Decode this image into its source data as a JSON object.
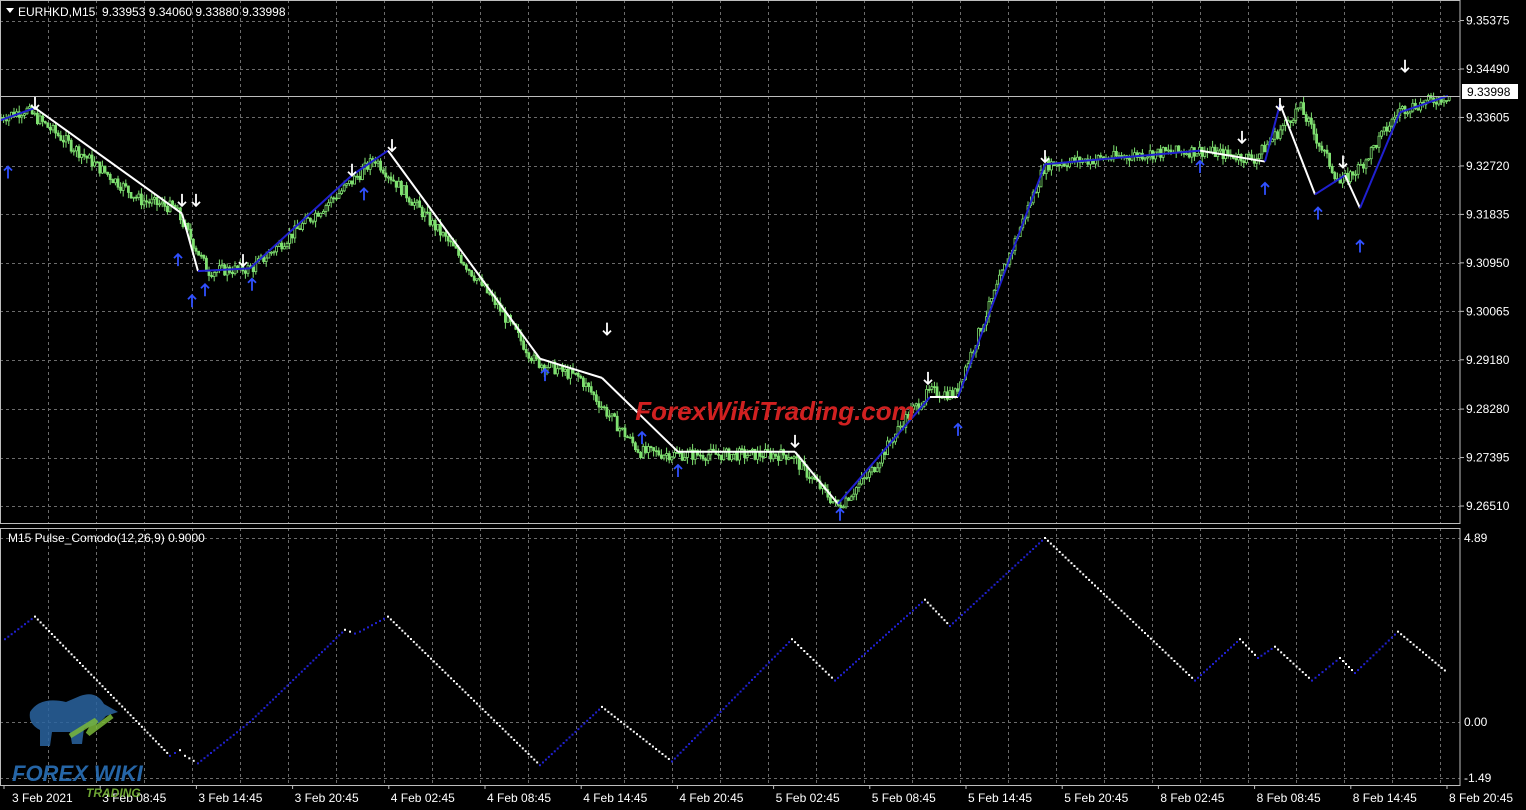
{
  "header": {
    "symbol": "EURHKD,M15",
    "ohlc": "9.33953 9.34060 9.33880 9.33998"
  },
  "current_price": "9.33998",
  "indicator": {
    "label": "M15 Pulse_Comodo(12,26,9) 0.9000"
  },
  "watermark": {
    "text": "ForexWikiTrading.com",
    "logo_line1": "FOREX WIKI",
    "logo_line2": "TRADING"
  },
  "colors": {
    "background": "#000000",
    "grid": "#6b6b6b",
    "candles": "#7fe070",
    "zigzag_down": "#ffffff",
    "zigzag_up": "#2020d0",
    "arrow_up": "#3050ff",
    "arrow_down": "#ffffff",
    "watermark": "#d02020"
  },
  "chart_data": [
    {
      "type": "line",
      "series": [
        {
          "name": "",
          "x": [
            0,
            26,
            140,
            175,
            208,
            252,
            300,
            350,
            375,
            450,
            500,
            535,
            580,
            612,
            640,
            678,
            720,
            790,
            838,
            870,
            905,
            930,
            955,
            1045,
            1100,
            1150,
            1200,
            1255,
            1300,
            1340,
            1360,
            1400,
            1448
          ],
          "y": [
            9.336,
            9.3375,
            9.321,
            9.3195,
            9.308,
            9.3085,
            9.316,
            9.324,
            9.3285,
            9.313,
            9.301,
            9.2915,
            9.2885,
            9.281,
            9.275,
            9.2745,
            9.2745,
            9.2745,
            9.265,
            9.271,
            9.281,
            9.286,
            9.2855,
            9.3275,
            9.3285,
            9.3295,
            9.33,
            9.3285,
            9.338,
            9.324,
            9.327,
            9.3375,
            9.34
          ]
        }
      ],
      "zigzag": {
        "x": [
          0,
          35,
          182,
          198,
          250,
          352,
          388,
          540,
          602,
          678,
          795,
          838,
          930,
          958,
          1045,
          1200,
          1265,
          1280,
          1315,
          1345,
          1360,
          1400,
          1448
        ],
        "y": [
          9.3355,
          9.3378,
          9.3185,
          9.308,
          9.3085,
          9.3255,
          9.33,
          9.292,
          9.2885,
          9.275,
          9.275,
          9.2655,
          9.285,
          9.285,
          9.3275,
          9.33,
          9.328,
          9.3385,
          9.322,
          9.3255,
          9.3195,
          9.337,
          9.34
        ],
        "dir": [
          "down",
          "down",
          "down",
          "up",
          "up",
          "up",
          "down",
          "up",
          "down",
          "up",
          "down",
          "up",
          "up",
          "up",
          "down",
          "up",
          "up",
          "down",
          "up",
          "down",
          "up",
          "down",
          "down"
        ]
      },
      "arrows_up": {
        "x": [
          8,
          178,
          192,
          205,
          252,
          364,
          545,
          642,
          678,
          840,
          958,
          1200,
          1265,
          1318,
          1360
        ],
        "y": [
          9.326,
          9.31,
          9.3025,
          9.3045,
          9.3055,
          9.322,
          9.289,
          9.2775,
          9.2715,
          9.2635,
          9.279,
          9.327,
          9.323,
          9.3185,
          9.3125
        ]
      },
      "arrows_down": {
        "x": [
          35,
          182,
          196,
          243,
          352,
          392,
          607,
          795,
          928,
          1045,
          1242,
          1280,
          1343,
          1405
        ],
        "y": [
          9.3387,
          9.321,
          9.321,
          9.31,
          9.3265,
          9.331,
          9.2975,
          9.277,
          9.2885,
          9.329,
          9.3325,
          9.3385,
          9.328,
          9.3455
        ]
      },
      "y_ticks": [
        "9.35375",
        "9.34490",
        "9.33605",
        "9.32720",
        "9.31835",
        "9.30950",
        "9.30065",
        "9.29180",
        "9.28280",
        "9.27395",
        "9.26510"
      ],
      "ylim": [
        9.262,
        9.3575
      ],
      "x_ticks": [
        "3 Feb 2021",
        "3 Feb 08:45",
        "3 Feb 14:45",
        "3 Feb 20:45",
        "4 Feb 02:45",
        "4 Feb 08:45",
        "4 Feb 14:45",
        "4 Feb 20:45",
        "5 Feb 02:45",
        "5 Feb 08:45",
        "5 Feb 14:45",
        "5 Feb 20:45",
        "8 Feb 02:45",
        "8 Feb 08:45",
        "8 Feb 14:45",
        "8 Feb 20:45"
      ],
      "grid": true
    },
    {
      "type": "line",
      "series": [
        {
          "name": "",
          "x": [
            5,
            35,
            170,
            180,
            185,
            198,
            250,
            345,
            355,
            360,
            388,
            540,
            602,
            672,
            792,
            835,
            925,
            950,
            1045,
            1195,
            1240,
            1258,
            1275,
            1312,
            1340,
            1355,
            1398,
            1448
          ],
          "y": [
            2.2,
            2.8,
            -0.9,
            -0.75,
            -0.9,
            -1.1,
            0.0,
            2.45,
            2.35,
            2.4,
            2.8,
            -1.15,
            0.4,
            -1.05,
            2.2,
            1.1,
            3.25,
            2.55,
            4.89,
            1.1,
            2.2,
            1.7,
            2.0,
            1.1,
            1.7,
            1.3,
            2.4,
            1.3
          ]
        }
      ],
      "direction": [
        "up",
        "down",
        "down",
        "up",
        "down",
        "down",
        "up",
        "up",
        "down",
        "up",
        "up",
        "down",
        "up",
        "down",
        "up",
        "down",
        "up",
        "down",
        "up",
        "down",
        "up",
        "down",
        "up",
        "down",
        "up",
        "down",
        "up",
        "down"
      ],
      "y_ticks": [
        "4.89",
        "0.00",
        "-1.49"
      ],
      "ylim": [
        -1.49,
        4.89
      ],
      "grid": true
    }
  ]
}
